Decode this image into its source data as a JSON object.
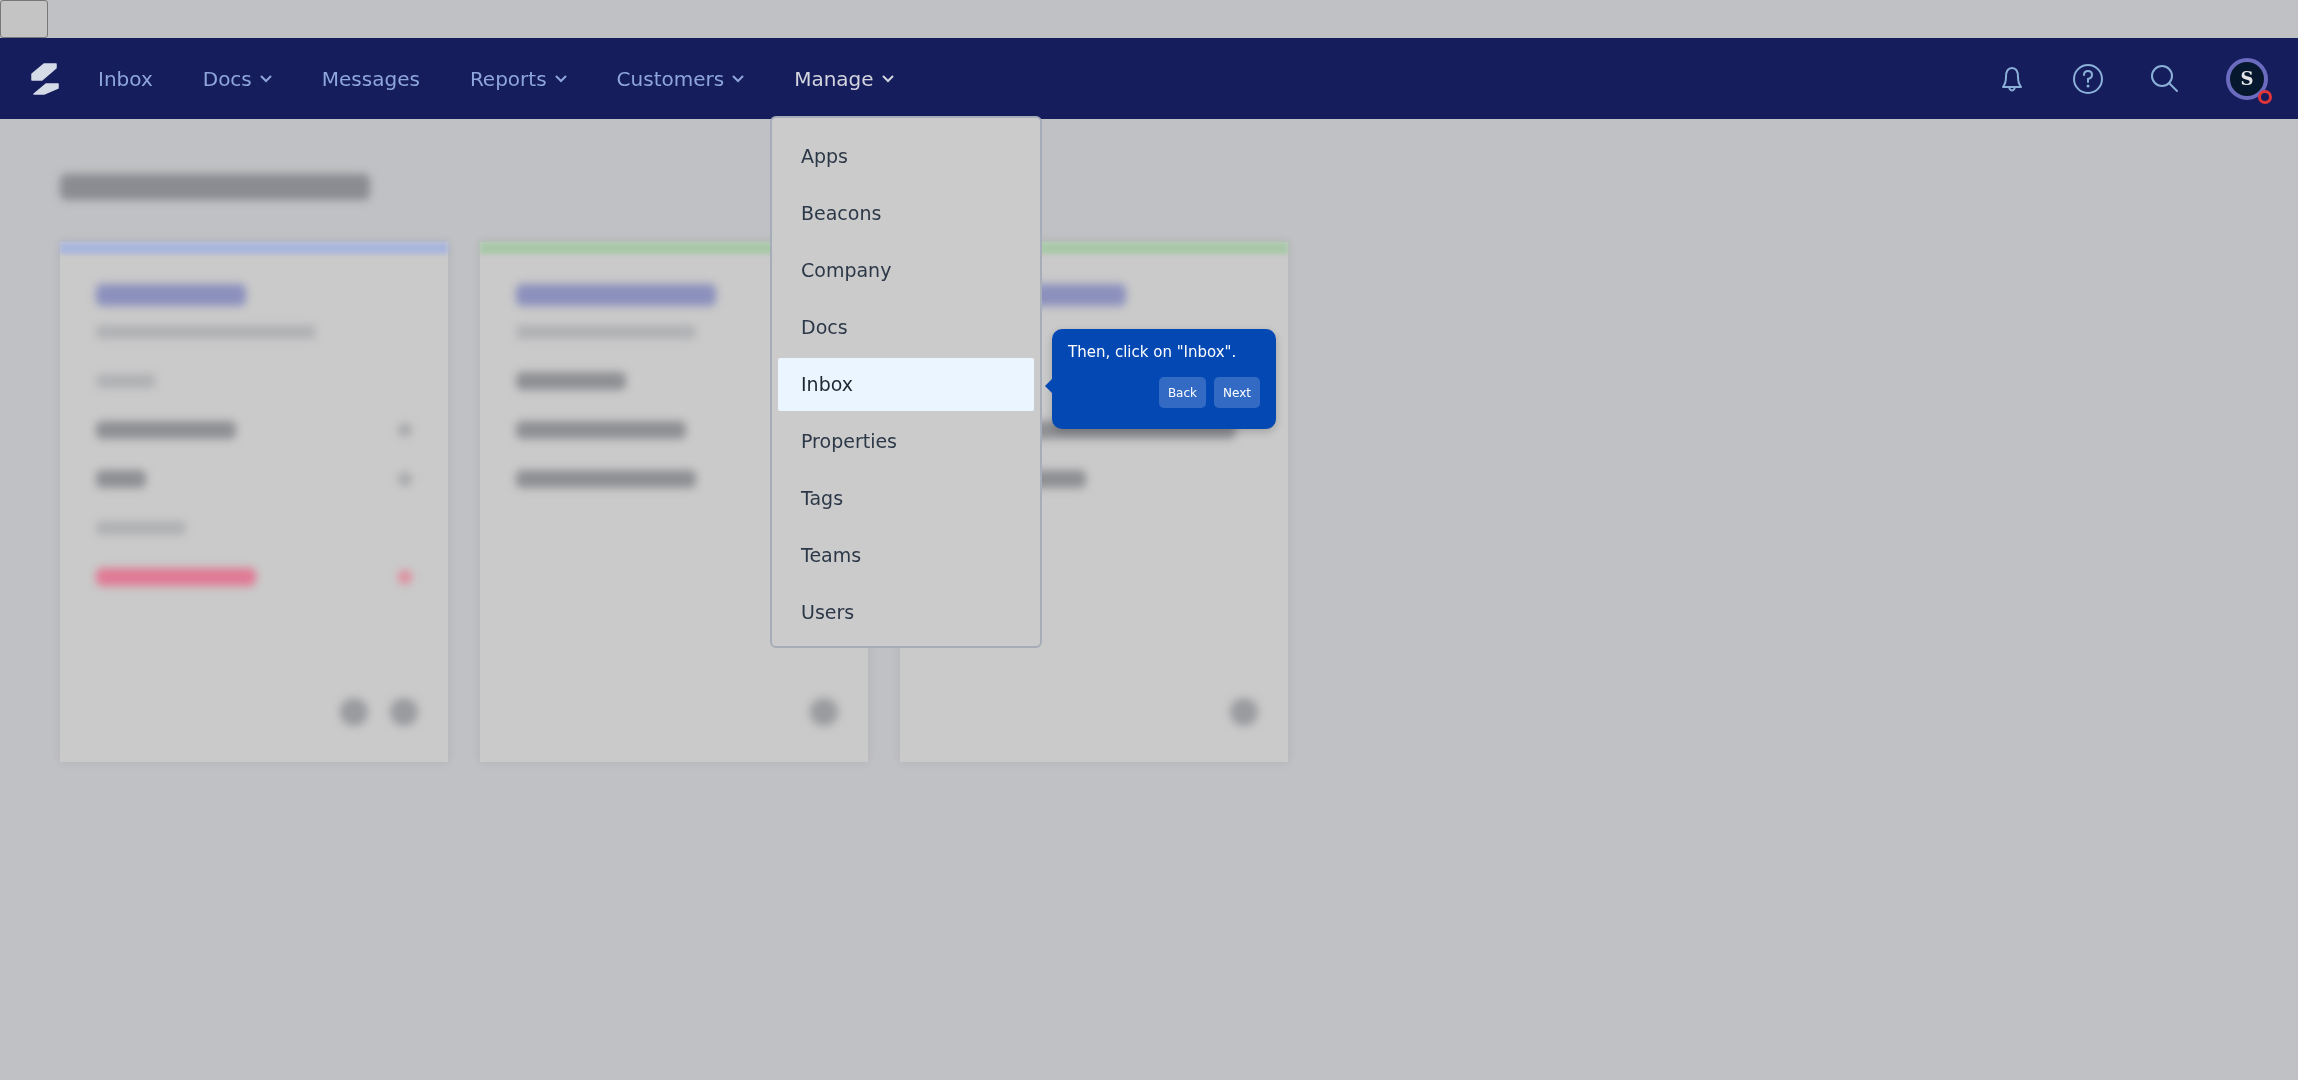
{
  "navbar": {
    "items": [
      {
        "label": "Inbox",
        "dropdown": false,
        "open": false
      },
      {
        "label": "Docs",
        "dropdown": true,
        "open": false
      },
      {
        "label": "Messages",
        "dropdown": false,
        "open": false
      },
      {
        "label": "Reports",
        "dropdown": true,
        "open": false
      },
      {
        "label": "Customers",
        "dropdown": true,
        "open": false
      },
      {
        "label": "Manage",
        "dropdown": true,
        "open": true
      }
    ],
    "avatar": {
      "initial": "S",
      "alert": true
    }
  },
  "dashboard": {
    "cards": [
      {
        "color": "#a9b6dc"
      },
      {
        "color": "#a8c8a8"
      },
      {
        "color": "#a8c8a8"
      }
    ]
  },
  "manage_menu": {
    "items": [
      {
        "label": "Apps",
        "selected": false
      },
      {
        "label": "Beacons",
        "selected": false
      },
      {
        "label": "Company",
        "selected": false
      },
      {
        "label": "Docs",
        "selected": false
      },
      {
        "label": "Inbox",
        "selected": true
      },
      {
        "label": "Properties",
        "selected": false
      },
      {
        "label": "Tags",
        "selected": false
      },
      {
        "label": "Teams",
        "selected": false
      },
      {
        "label": "Users",
        "selected": false
      }
    ]
  },
  "tooltip": {
    "text": "Then, click on \"Inbox\".",
    "buttons": [
      "Back",
      "Next"
    ]
  }
}
